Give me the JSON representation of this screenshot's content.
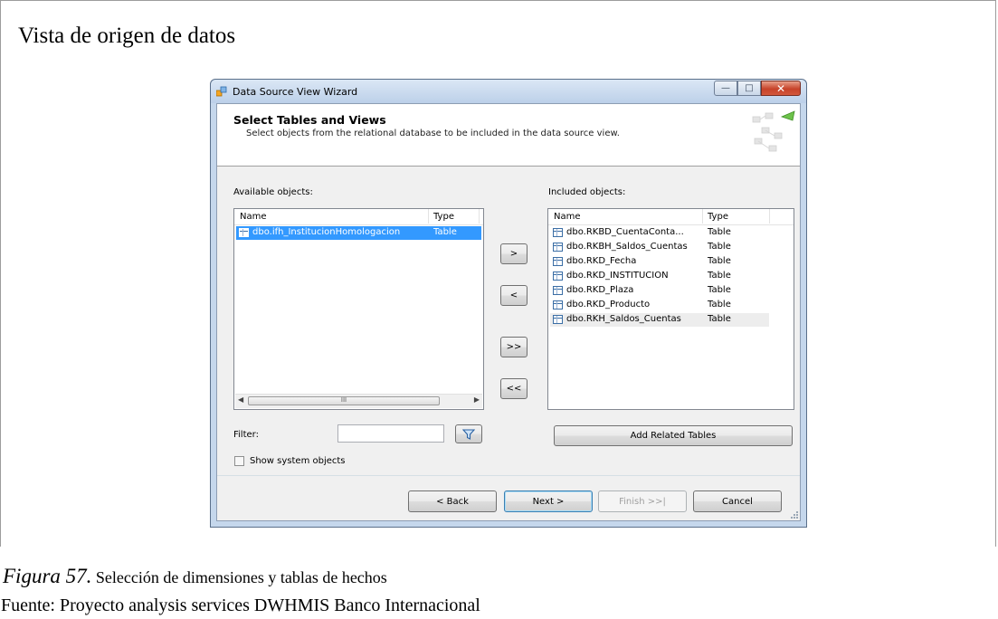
{
  "document": {
    "heading": "Vista de origen de datos",
    "figure_label": "Figura 57.",
    "figure_caption": " Selección de dimensiones y tablas de hechos",
    "source": "Fuente: Proyecto analysis services DWHMIS Banco Internacional"
  },
  "window": {
    "title": "Data Source View Wizard",
    "minimize_icon": "minimize-icon",
    "maximize_icon": "maximize-icon",
    "close_icon": "close-icon"
  },
  "banner": {
    "title": "Select Tables and Views",
    "description": "Select objects from the relational database to be included in the data source view."
  },
  "available": {
    "label": "Available objects:",
    "columns": [
      "Name",
      "Type"
    ],
    "rows": [
      {
        "name": "dbo.ifh_InstitucionHomologacion",
        "type": "Table"
      }
    ],
    "scrollbar_thumb": "III"
  },
  "included": {
    "label": "Included objects:",
    "columns": [
      "Name",
      "Type"
    ],
    "rows": [
      {
        "name": "dbo.RKBD_CuentaConta...",
        "type": "Table"
      },
      {
        "name": "dbo.RKBH_Saldos_Cuentas",
        "type": "Table"
      },
      {
        "name": "dbo.RKD_Fecha",
        "type": "Table"
      },
      {
        "name": "dbo.RKD_INSTITUCION",
        "type": "Table"
      },
      {
        "name": "dbo.RKD_Plaza",
        "type": "Table"
      },
      {
        "name": "dbo.RKD_Producto",
        "type": "Table"
      },
      {
        "name": "dbo.RKH_Saldos_Cuentas",
        "type": "Table"
      }
    ]
  },
  "move_buttons": {
    "add": ">",
    "remove": "<",
    "add_all": ">>",
    "remove_all": "<<"
  },
  "filter": {
    "label": "Filter:",
    "value": "",
    "icon": "filter-icon"
  },
  "show_system_objects": {
    "label": "Show system objects",
    "checked": false
  },
  "add_related_tables": "Add Related Tables",
  "nav": {
    "back": "< Back",
    "next": "Next >",
    "finish": "Finish >>|",
    "cancel": "Cancel"
  }
}
